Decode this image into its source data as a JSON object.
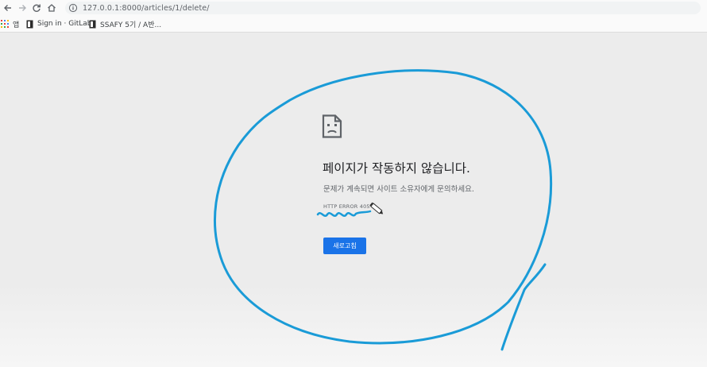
{
  "toolbar": {
    "url": "127.0.0.1:8000/articles/1/delete/"
  },
  "bookmarks": {
    "apps_label": "앱",
    "items": [
      {
        "label": "Sign in · GitLab"
      },
      {
        "label": "SSAFY 5기 / A반..."
      }
    ]
  },
  "error_page": {
    "icon": "sad-page-icon",
    "headline": "페이지가 작동하지 않습니다.",
    "subtext": "문제가 계속되면 사이트 소유자에게 문의하세요.",
    "error_code": "HTTP ERROR 405",
    "reload_label": "새로고침"
  },
  "colors": {
    "accent_button": "#1a73e8",
    "annotation_stroke": "#1a9bd7"
  }
}
